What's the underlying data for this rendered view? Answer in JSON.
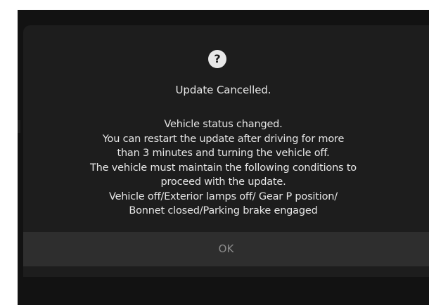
{
  "dialog": {
    "icon": "question-mark-icon",
    "icon_glyph": "?",
    "title": "Update Cancelled.",
    "message_lines": [
      "Vehicle status changed.",
      "You can restart the update after driving for more",
      "than 3 minutes and turning the vehicle off.",
      "The vehicle must maintain the following conditions to",
      "proceed with the update.",
      "Vehicle off/Exterior lamps off/ Gear P position/",
      "Bonnet closed/Parking brake engaged"
    ],
    "ok_label": "OK"
  },
  "colors": {
    "background": "#121212",
    "dialog": "#1d1d1d",
    "button": "#2e2e2e",
    "text": "#e6e6e6",
    "button_text": "#8c8c8c"
  }
}
